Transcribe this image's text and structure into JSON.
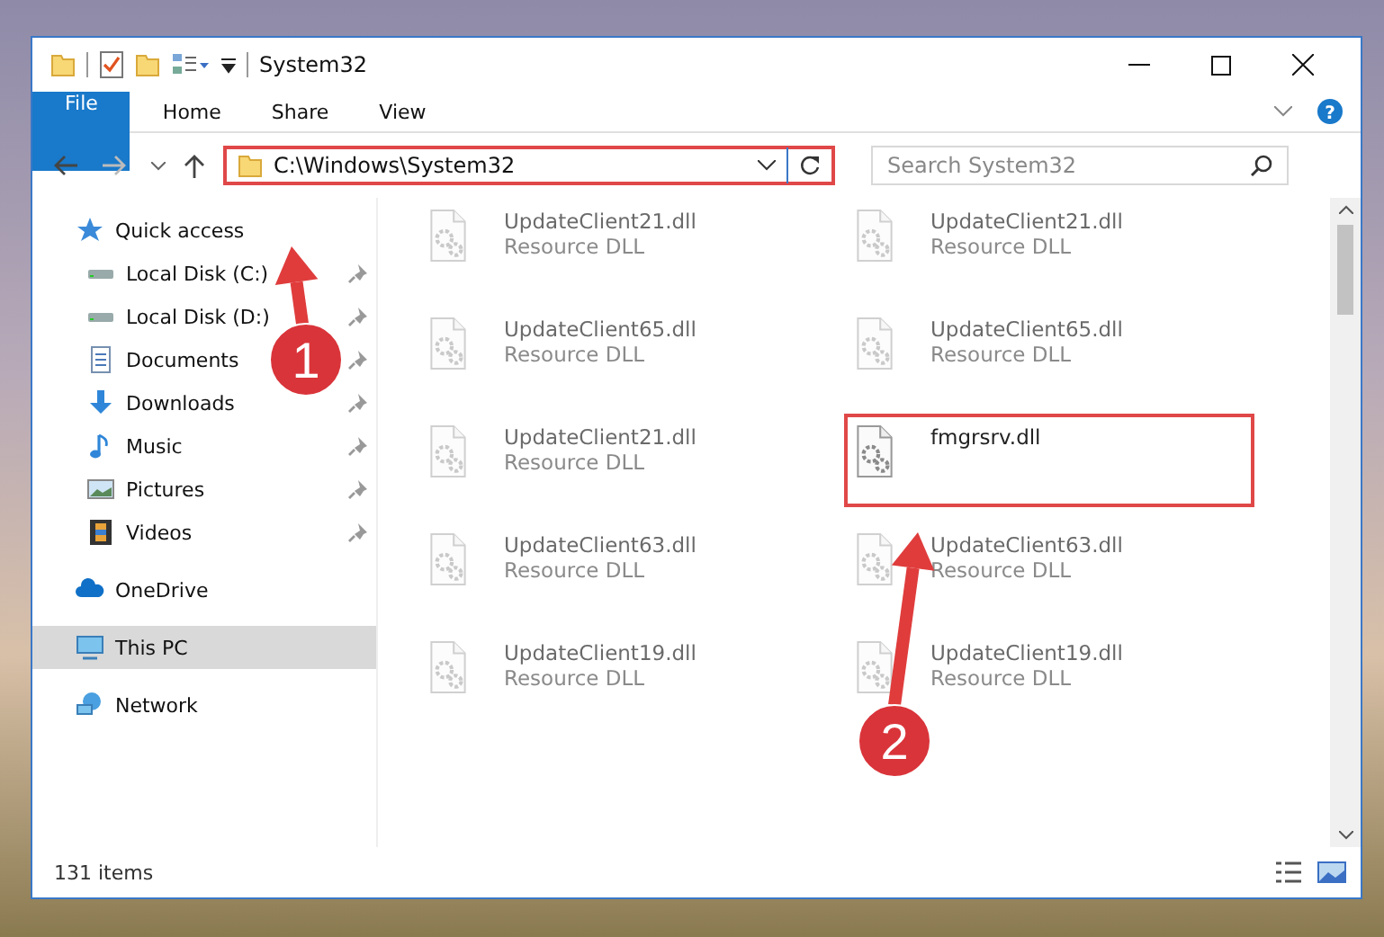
{
  "window": {
    "title": "System32"
  },
  "ribbon_tabs": [
    {
      "label": "File",
      "kind": "file"
    },
    {
      "label": "Home",
      "kind": "tab"
    },
    {
      "label": "Share",
      "kind": "tab"
    },
    {
      "label": "View",
      "kind": "tab"
    }
  ],
  "help_button": "?",
  "address": {
    "path": "C:\\Windows\\System32",
    "highlighted": true
  },
  "search": {
    "placeholder": "Search System32"
  },
  "sidebar": {
    "items": [
      {
        "label": "Quick access",
        "kind": "star",
        "selected": false,
        "children": [
          {
            "label": "Local Disk (C:)",
            "kind": "drive",
            "pinned": true,
            "selected": false
          },
          {
            "label": "Local Disk (D:)",
            "kind": "drive",
            "pinned": true,
            "selected": false
          },
          {
            "label": "Documents",
            "kind": "documents",
            "pinned": true,
            "selected": false
          },
          {
            "label": "Downloads",
            "kind": "downloads",
            "pinned": true,
            "selected": false
          },
          {
            "label": "Music",
            "kind": "music",
            "pinned": true,
            "selected": false
          },
          {
            "label": "Pictures",
            "kind": "pictures",
            "pinned": true,
            "selected": false
          },
          {
            "label": "Videos",
            "kind": "videos",
            "pinned": true,
            "selected": false
          }
        ]
      },
      {
        "label": "OneDrive",
        "kind": "cloud",
        "selected": false
      },
      {
        "label": "This PC",
        "kind": "pc",
        "selected": true
      },
      {
        "label": "Network",
        "kind": "network",
        "selected": false
      }
    ]
  },
  "files": [
    {
      "name": "UpdateClient21.dll",
      "type": "Resource DLL",
      "blurred": true,
      "highlighted": false
    },
    {
      "name": "UpdateClient21.dll",
      "type": "Resource DLL",
      "blurred": true,
      "highlighted": false
    },
    {
      "name": "UpdateClient65.dll",
      "type": "Resource DLL",
      "blurred": true,
      "highlighted": false
    },
    {
      "name": "UpdateClient65.dll",
      "type": "Resource DLL",
      "blurred": true,
      "highlighted": false
    },
    {
      "name": "UpdateClient21.dll",
      "type": "Resource DLL",
      "blurred": true,
      "highlighted": false
    },
    {
      "name": "fmgrsrv.dll",
      "blurred": false,
      "highlighted": true
    },
    {
      "name": "UpdateClient63.dll",
      "type": "Resource DLL",
      "blurred": true,
      "highlighted": false
    },
    {
      "name": "UpdateClient63.dll",
      "type": "Resource DLL",
      "blurred": true,
      "highlighted": false
    },
    {
      "name": "UpdateClient19.dll",
      "type": "Resource DLL",
      "blurred": true,
      "highlighted": false
    },
    {
      "name": "UpdateClient19.dll",
      "type": "Resource DLL",
      "blurred": true,
      "highlighted": false
    }
  ],
  "status_bar": {
    "item_count": "131 items"
  },
  "annotations": [
    {
      "label": "1"
    },
    {
      "label": "2"
    }
  ]
}
